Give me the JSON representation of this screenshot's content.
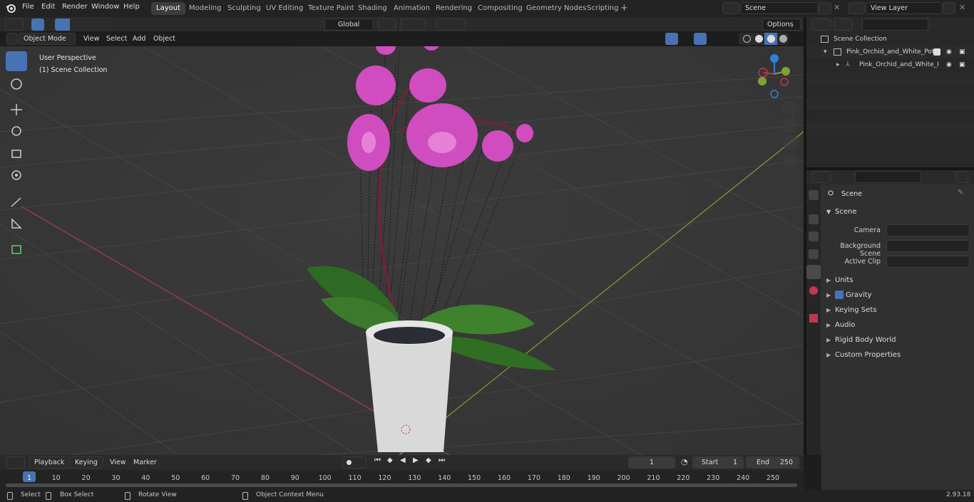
{
  "menu": {
    "items": [
      "File",
      "Edit",
      "Render",
      "Window",
      "Help"
    ]
  },
  "workspaces": [
    "Layout",
    "Modeling",
    "Sculpting",
    "UV Editing",
    "Texture Paint",
    "Shading",
    "Animation",
    "Rendering",
    "Compositing",
    "Geometry Nodes",
    "Scripting"
  ],
  "scene_field": "Scene",
  "view_layer_field": "View Layer",
  "viewport_header": {
    "mode": "Object Mode",
    "menus": [
      "View",
      "Select",
      "Add",
      "Object"
    ],
    "transform_orientation": "Global",
    "options_label": "Options"
  },
  "viewport": {
    "perspective_label": "User Perspective",
    "collection_label": "(1) Scene Collection",
    "gizmo_axes": [
      "X",
      "Y",
      "Z"
    ]
  },
  "outliner": {
    "root": "Scene Collection",
    "items": [
      "Pink_Orchid_and_White_Pot_(",
      "Pink_Orchid_and_White_I"
    ]
  },
  "properties": {
    "context_title": "Scene",
    "panel_title": "Scene",
    "fields": [
      {
        "label": "Camera"
      },
      {
        "label": "Background Scene"
      },
      {
        "label": "Active Clip"
      }
    ],
    "sections": [
      "Units",
      "Gravity",
      "Keying Sets",
      "Audio",
      "Rigid Body World",
      "Custom Properties"
    ]
  },
  "timeline": {
    "menus": [
      "Playback",
      "Keying",
      "View",
      "Marker"
    ],
    "current_frame": "1",
    "start_label": "Start",
    "start_value": "1",
    "end_label": "End",
    "end_value": "250",
    "ticks": [
      "1",
      "10",
      "20",
      "30",
      "40",
      "50",
      "60",
      "70",
      "80",
      "90",
      "100",
      "110",
      "120",
      "130",
      "140",
      "150",
      "160",
      "170",
      "180",
      "190",
      "200",
      "210",
      "220",
      "230",
      "240",
      "250"
    ]
  },
  "statusbar": {
    "select": "Select",
    "box_select": "Box Select",
    "rotate_view": "Rotate View",
    "context_menu": "Object Context Menu",
    "version": "2.93.18"
  },
  "colors": {
    "accent": "#4772b3",
    "x_axis": "#c0394b",
    "y_axis": "#7ea13a",
    "z_axis": "#2f7fd6"
  }
}
